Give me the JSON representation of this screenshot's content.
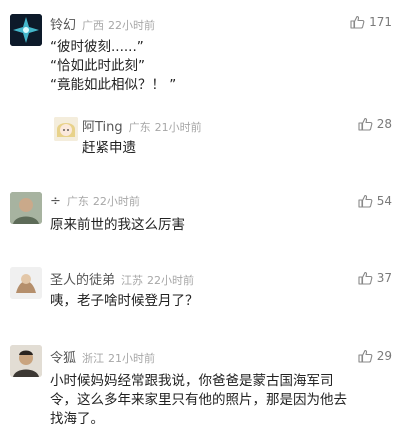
{
  "comments": [
    {
      "name": "铃幻",
      "location": "广西",
      "time": "22小时前",
      "likes": "171",
      "lines": [
        "“彼时彼刻......”",
        "“恰如此时此刻”",
        "“竟能如此相似？！ ”"
      ],
      "avatar_color": "#0e1b2c",
      "reply": {
        "name": "阿Ting",
        "location": "广东",
        "time": "21小时前",
        "likes": "28",
        "text": "赶紧申遗"
      }
    },
    {
      "name": "÷",
      "location": "广东",
      "time": "22小时前",
      "likes": "54",
      "text": "原来前世的我这么厉害"
    },
    {
      "name": "圣人的徒弟",
      "location": "江苏",
      "time": "22小时前",
      "likes": "37",
      "text": "咦，老子啥时候登月了？"
    },
    {
      "name": "令狐",
      "location": "浙江",
      "time": "21小时前",
      "likes": "29",
      "lines": [
        "小时候妈妈经常跟我说，你爸爸是蒙古国海军司",
        "令，这么多年来家里只有他的照片，那是因为他去",
        "找海了。"
      ]
    }
  ]
}
